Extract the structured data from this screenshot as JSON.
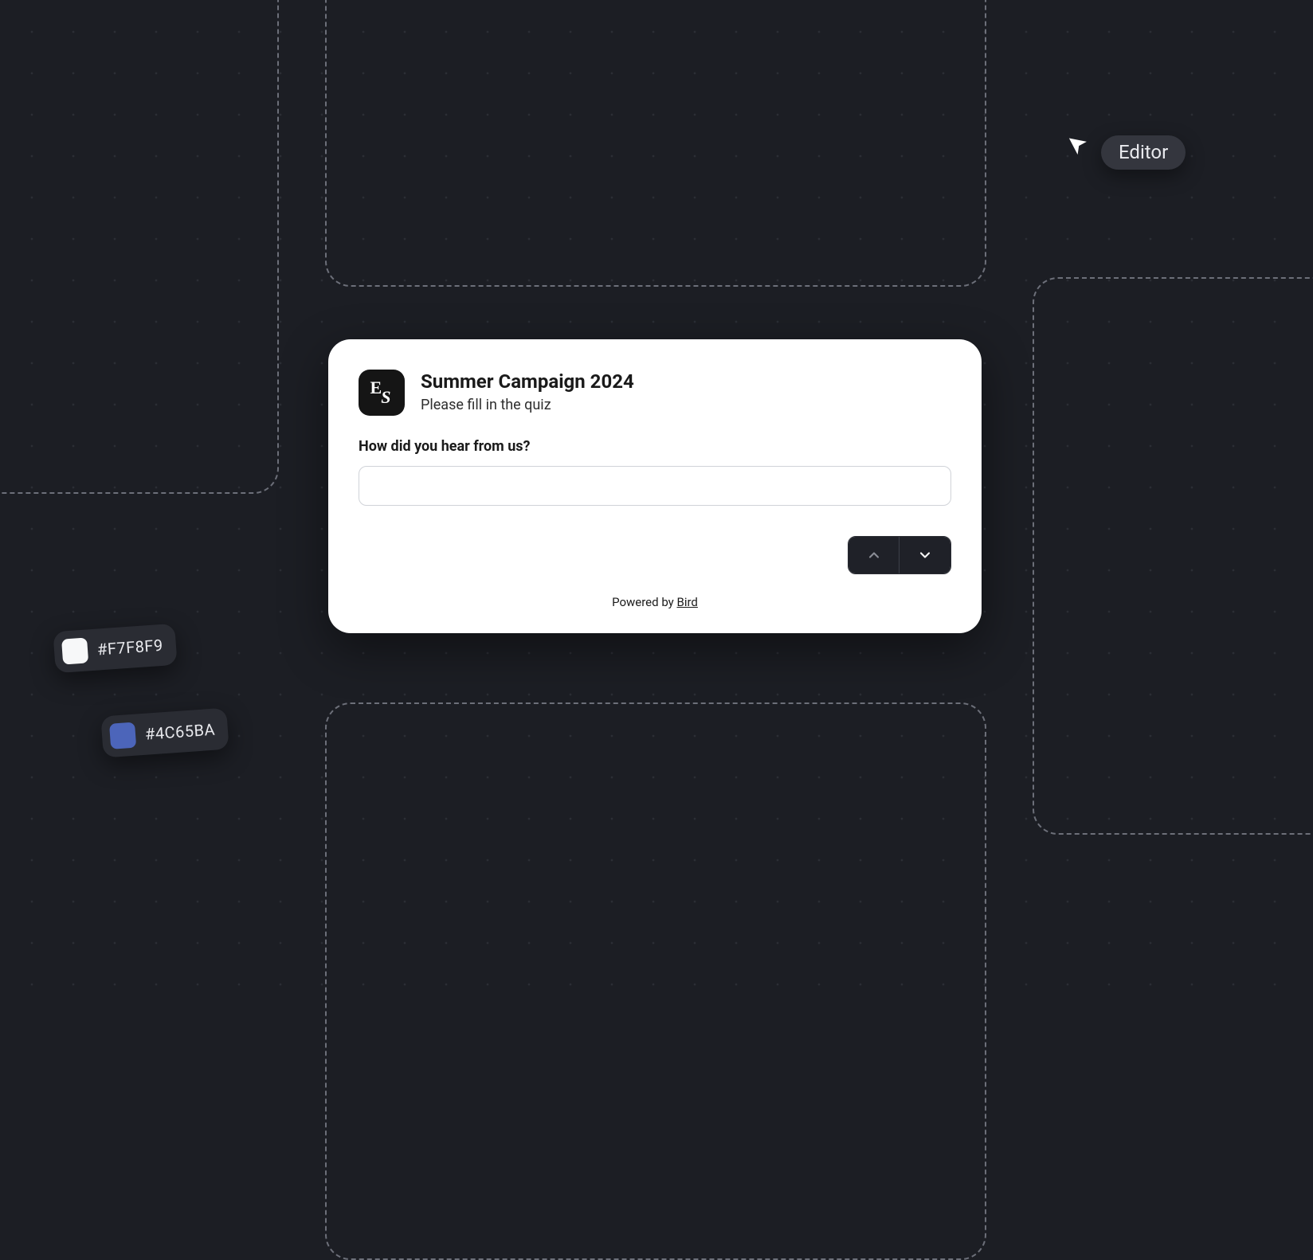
{
  "cursor": {
    "label": "Editor"
  },
  "swatches": [
    {
      "hex": "#F7F8F9"
    },
    {
      "hex": "#4C65BA"
    }
  ],
  "card": {
    "logo_mark": "ES",
    "title": "Summer Campaign 2024",
    "subtitle": "Please fill in the quiz",
    "question": "How did you hear from us?",
    "answer_value": "",
    "powered_prefix": "Powered by ",
    "powered_link": "Bird"
  }
}
